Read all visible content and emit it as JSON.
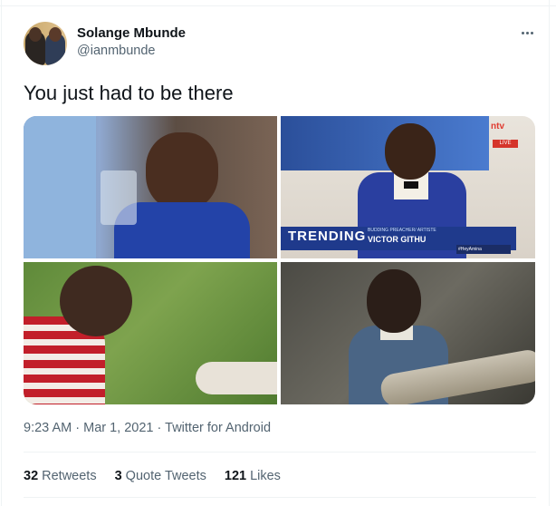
{
  "author": {
    "name": "Solange Mbunde",
    "handle": "@ianmbunde"
  },
  "tweet": {
    "text": "You just had to be there"
  },
  "media": {
    "overlay": {
      "channel_logo": "ntv",
      "live_badge": "LIVE",
      "show_logo": "TRENDING",
      "caption_top": "BUDDING PREACHER/ ARTISTE",
      "caption_name": "VICTOR GITHU",
      "hashtag": "#HeyAmina"
    }
  },
  "meta": {
    "time": "9:23 AM",
    "sep1": "·",
    "date": "Mar 1, 2021",
    "sep2": "·",
    "source": "Twitter for Android"
  },
  "stats": [
    {
      "count": "32",
      "label": "Retweets"
    },
    {
      "count": "3",
      "label": "Quote Tweets"
    },
    {
      "count": "121",
      "label": "Likes"
    }
  ],
  "icons": {
    "more": "more-horizontal-icon"
  }
}
